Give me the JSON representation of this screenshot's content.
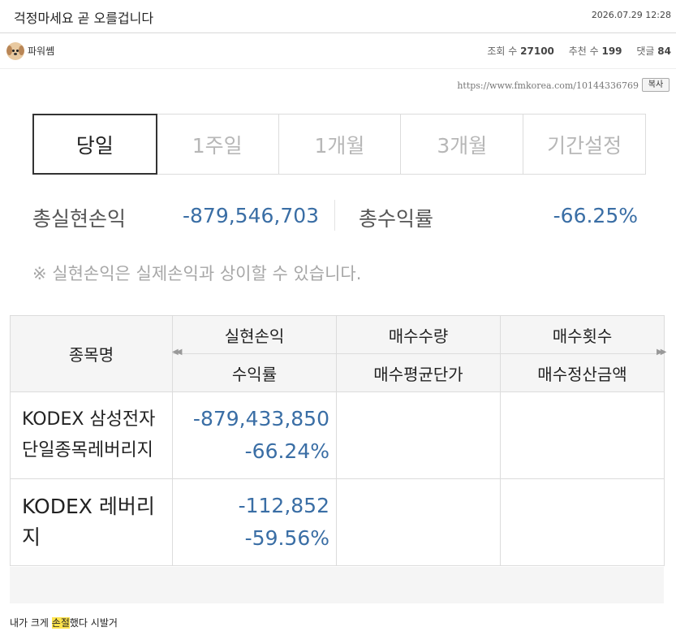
{
  "post": {
    "title": "걱정마세요 곧 오를겁니다",
    "date": "2026.07.29 12:28",
    "author": "파워쏌",
    "views_label": "조회 수",
    "views": "27100",
    "likes_label": "추천 수",
    "likes": "199",
    "comments_label": "댓글",
    "comments": "84",
    "url": "https://www.fmkorea.com/10144336769",
    "copy_label": "복사"
  },
  "tabs": [
    {
      "label": "당일",
      "active": true
    },
    {
      "label": "1주일",
      "active": false
    },
    {
      "label": "1개월",
      "active": false
    },
    {
      "label": "3개월",
      "active": false
    },
    {
      "label": "기간설정",
      "active": false
    }
  ],
  "summary": {
    "realized_label": "총실현손익",
    "realized_value": "-879,546,703",
    "return_label": "총수익률",
    "return_value": "-66.25%"
  },
  "note": "※ 실현손익은 실제손익과 상이할 수 있습니다.",
  "table": {
    "headers": {
      "name": "종목명",
      "realized": "실현손익",
      "return": "수익률",
      "buy_qty": "매수수량",
      "buy_avg": "매수평균단가",
      "buy_count": "매수횟수",
      "buy_amount": "매수정산금액"
    },
    "rows": [
      {
        "name_line1": "KODEX 삼성전자",
        "name_line2": "단일종목레버리지",
        "realized": "-879,433,850",
        "return": "-66.24%"
      },
      {
        "name_line1": "KODEX 레버리",
        "name_line2": "지",
        "realized": "-112,852",
        "return": "-59.56%"
      }
    ]
  },
  "comment": {
    "prefix": "내가 크게 ",
    "highlight": "손절",
    "suffix": "했다 시발거"
  },
  "colors": {
    "value_blue": "#3a6ea5",
    "highlight": "#ffe44d"
  }
}
